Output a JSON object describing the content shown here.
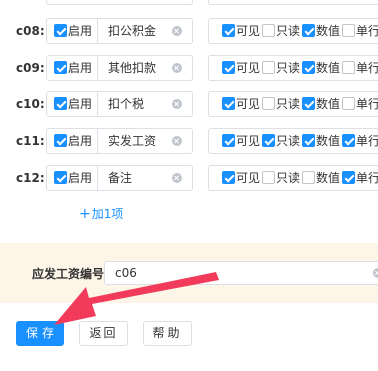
{
  "rows": [
    {
      "id": "c08:",
      "enable_label": "启用",
      "enabled": true,
      "name": "扣公积金",
      "visible": true,
      "readonly": false,
      "numeric": true,
      "single_line": false
    },
    {
      "id": "c09:",
      "enable_label": "启用",
      "enabled": true,
      "name": "其他扣款",
      "visible": true,
      "readonly": false,
      "numeric": true,
      "single_line": false
    },
    {
      "id": "c10:",
      "enable_label": "启用",
      "enabled": true,
      "name": "扣个税",
      "visible": true,
      "readonly": false,
      "numeric": true,
      "single_line": false
    },
    {
      "id": "c11:",
      "enable_label": "启用",
      "enabled": true,
      "name": "实发工资",
      "visible": true,
      "readonly": true,
      "numeric": true,
      "single_line": true
    },
    {
      "id": "c12:",
      "enable_label": "启用",
      "enabled": true,
      "name": "备注",
      "visible": true,
      "readonly": false,
      "numeric": false,
      "single_line": true
    }
  ],
  "perm_labels": {
    "visible": "可见",
    "readonly": "只读",
    "numeric": "数值",
    "single_line": "单行"
  },
  "add_link": {
    "plus": "+",
    "label": "加1项"
  },
  "salary_field": {
    "label": "应发工资编号:",
    "value": "c06"
  },
  "buttons": {
    "save": "保存",
    "back": "返回",
    "help": "帮助"
  },
  "colors": {
    "primary": "#1890ff",
    "form_bg": "#fdf6e8",
    "arrow": "#f23a5a"
  },
  "icons": {
    "clear": "clear-icon",
    "checkbox": "checkbox-icon",
    "arrow": "pointer-arrow"
  }
}
